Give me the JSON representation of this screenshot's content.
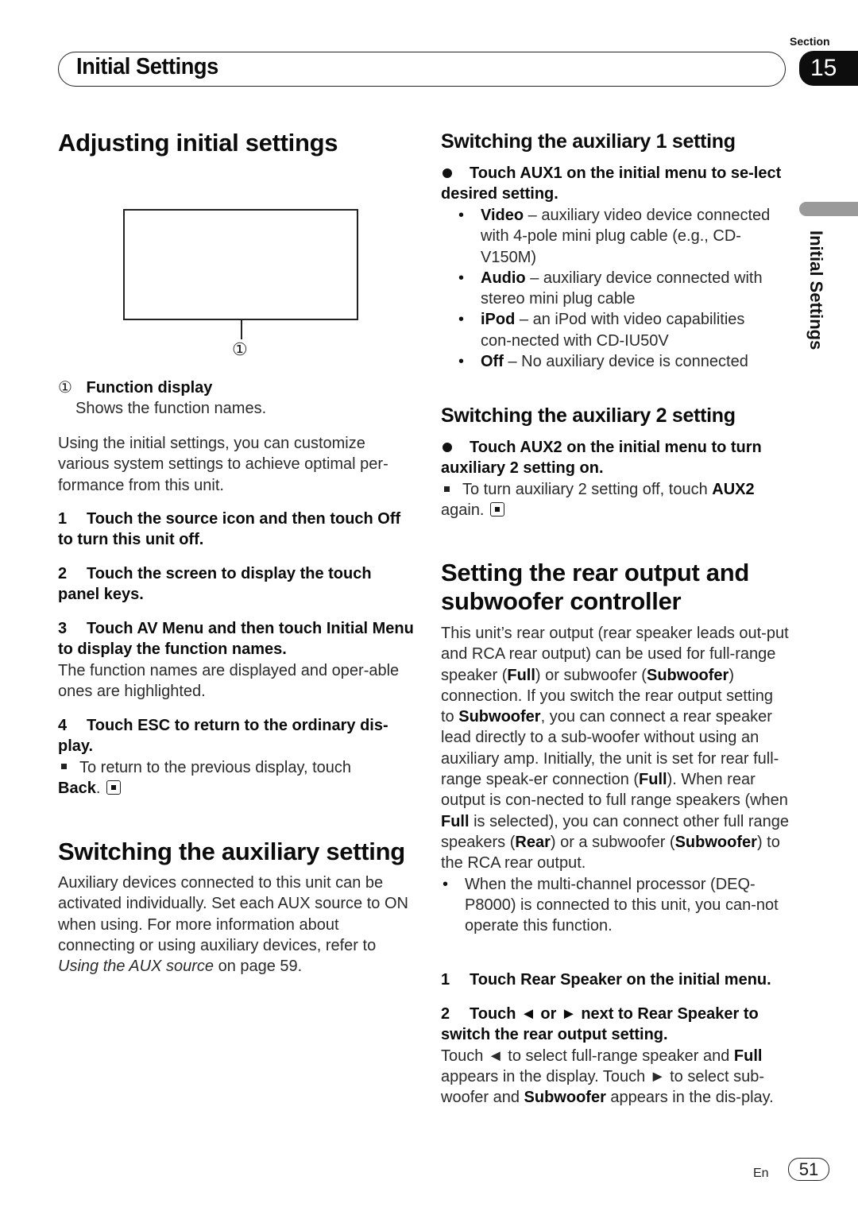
{
  "header": {
    "section_label": "Section",
    "section_number": "15",
    "title": "Initial Settings",
    "side_tab": "Initial Settings"
  },
  "left": {
    "heading": "Adjusting initial settings",
    "diagram": {
      "callout_marker": "①",
      "legend_marker": "①",
      "legend_title": "Function display",
      "legend_desc": "Shows the function names."
    },
    "intro": "Using the initial settings, you can customize various system settings to achieve optimal per-formance from this unit.",
    "steps": [
      {
        "num": "1",
        "text": "Touch the source icon and then touch Off to turn this unit off."
      },
      {
        "num": "2",
        "text": "Touch the screen to display the touch panel keys."
      },
      {
        "num": "3",
        "text": "Touch AV Menu and then touch Initial Menu to display the function names.",
        "desc": "The function names are displayed and oper-able ones are highlighted."
      },
      {
        "num": "4",
        "text": "Touch ESC to return to the ordinary dis-play.",
        "note_pre": "To return to the previous display, touch",
        "note_bold": "Back",
        "note_post": "."
      }
    ],
    "aux_section": {
      "heading": "Switching the auxiliary setting",
      "body_pre": "Auxiliary devices connected to this unit can be activated individually. Set each AUX source to ON when using. For more information about connecting or using auxiliary devices, refer to ",
      "body_italic": "Using the AUX source",
      "body_post": " on page 59."
    }
  },
  "right": {
    "aux1": {
      "heading": "Switching the auxiliary 1 setting",
      "instruction": "Touch AUX1 on the initial menu to se-lect desired setting.",
      "options": [
        {
          "label": "Video",
          "desc": " – auxiliary video device connected with 4-pole mini plug cable (e.g., CD-V150M)"
        },
        {
          "label": "Audio",
          "desc": " – auxiliary device connected with stereo mini plug cable"
        },
        {
          "label": "iPod",
          "desc": " – an iPod with video capabilities con-nected with CD-IU50V"
        },
        {
          "label": "Off",
          "desc": " – No auxiliary device is connected"
        }
      ]
    },
    "aux2": {
      "heading": "Switching the auxiliary 2 setting",
      "instruction": "Touch AUX2 on the initial menu to turn auxiliary 2 setting on.",
      "note_pre": "To turn auxiliary 2 setting off, touch ",
      "note_bold": "AUX2",
      "note_post": " again."
    },
    "rear": {
      "heading": "Setting the rear output and subwoofer controller",
      "p1": "This unit’s rear output (rear speaker leads out-put and RCA rear output) can be used for full-range speaker (",
      "full": "Full",
      "p2": ") or subwoofer (",
      "subwoofer": "Subwoofer",
      "p3": ") connection. If you switch the rear output setting to ",
      "p4": ", you can connect a rear speaker lead directly to a sub-woofer without using an auxiliary amp. Initially, the unit is set for rear full-range speak-er connection (",
      "p5": "). When rear output is con-nected to full range speakers (when ",
      "p6": " is selected), you can connect other full range speakers (",
      "rear_label": "Rear",
      "p7": ") or a subwoofer (",
      "p8": ") to the RCA rear output.",
      "bullet": "When the multi-channel processor (DEQ-P8000) is connected to this unit, you can-not operate this function.",
      "step1": {
        "num": "1",
        "text": "Touch Rear Speaker on the initial menu."
      },
      "step2": {
        "num": "2",
        "text": "Touch ◄ or ► next to Rear Speaker to switch the rear output setting."
      },
      "step2_desc": {
        "a": "Touch ◄ to select full-range speaker and ",
        "full": "Full",
        "b": " appears in the display. Touch ► to select sub-woofer and ",
        "subwoofer": "Subwoofer",
        "c": " appears in the dis-play."
      }
    }
  },
  "footer": {
    "lang": "En",
    "page": "51"
  }
}
